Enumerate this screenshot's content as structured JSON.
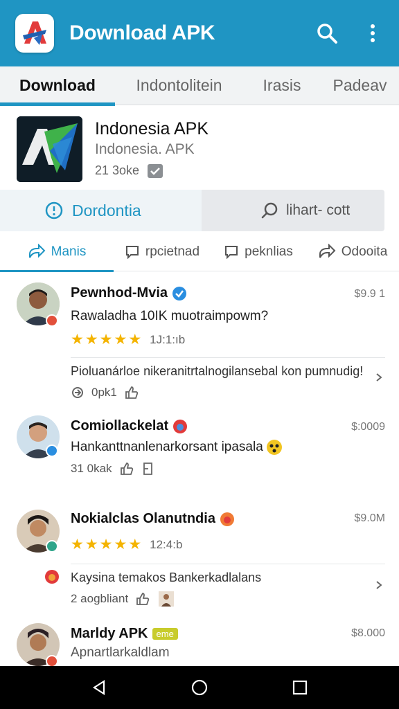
{
  "appbar": {
    "title": "Download APK",
    "icons": {
      "logo": "app-logo-icon",
      "search": "search-icon",
      "more": "more-vert-icon"
    },
    "accent": "#1f95c3"
  },
  "tabs": [
    {
      "label": "Download",
      "active": true
    },
    {
      "label": "Indontolitein",
      "active": false
    },
    {
      "label": "Irasis",
      "active": false
    },
    {
      "label": "Padeav",
      "active": false
    }
  ],
  "app": {
    "name": "Indonesia APK",
    "subtitle": "Indonesia. APK",
    "meta": "21 3oke"
  },
  "actions": {
    "primary_label": "Dordontia",
    "secondary_label": "lihart‑‎‎ ⁠‎‎‎‎‎‎cott"
  },
  "subtabs": [
    {
      "label": "Manis",
      "icon": "share-icon",
      "active": true
    },
    {
      "label": "rpcietnad",
      "icon": "comment-icon",
      "active": false
    },
    {
      "label": "peknlias",
      "icon": "comment-icon",
      "active": false
    },
    {
      "label": "Odooita",
      "icon": "forward-icon",
      "active": false
    }
  ],
  "reviews": [
    {
      "name": "Pewnhod‑Mvia",
      "date": "$9.9 1",
      "text": "Rawaladha 10IK muotraimpowm?",
      "rating": 5,
      "time": "1J:1:ıb",
      "reply": "Pioluanárloe nikeranitrtalnogilansebal kon pumnudig!",
      "reply_meta": "0pk1"
    },
    {
      "name": "Comiollackelat",
      "date": "$:0009",
      "text": "Hankanttnanlenarkorsant ipasala",
      "meta": "31 0kak"
    },
    {
      "name": "Nokialclas Olanutndia",
      "date": "$9.0M",
      "rating": 5,
      "time": "12:4:b",
      "reply": "Kaysina temakos Bankerkadlalans",
      "reply_meta": "2 aogbliant"
    },
    {
      "name": "Marldy APK",
      "badge": "eme",
      "date": "$8.000",
      "text": "Apnartlarkaldlam"
    }
  ],
  "navbar": {
    "back": "back-triangle-icon",
    "home": "home-circle-icon",
    "recents": "recents-square-icon"
  }
}
